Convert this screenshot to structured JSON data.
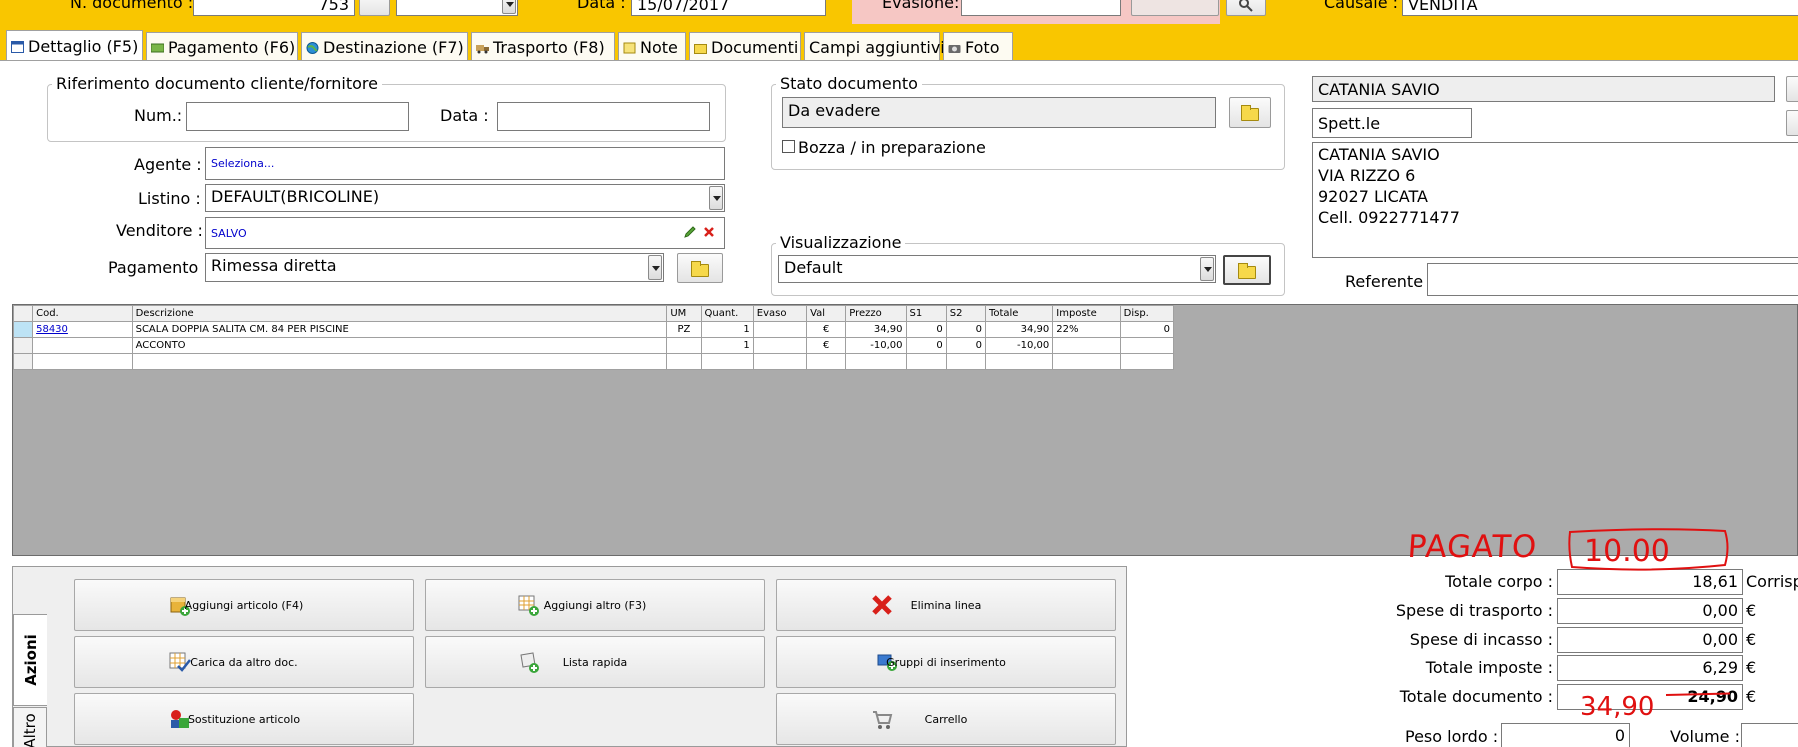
{
  "header": {
    "num_doc_label": "N. documento :",
    "num_doc_value": "753",
    "data_label": "Data :",
    "data_value": "15/07/2017",
    "evasione_label": "Evasione:",
    "causale_label": "Causale :",
    "causale_value": "VENDITA"
  },
  "tabs": [
    {
      "label": "Dettaglio (F5)"
    },
    {
      "label": "Pagamento (F6)"
    },
    {
      "label": "Destinazione (F7)"
    },
    {
      "label": "Trasporto (F8)"
    },
    {
      "label": "Note"
    },
    {
      "label": "Documenti"
    },
    {
      "label": "Campi aggiuntivi"
    },
    {
      "label": "Foto"
    }
  ],
  "riferimento": {
    "title": "Riferimento documento cliente/fornitore",
    "num_label": "Num.:",
    "num_value": "",
    "data_label": "Data :",
    "data_value": ""
  },
  "stato": {
    "title": "Stato documento",
    "value": "Da evadere",
    "bozza_label": "Bozza / in preparazione"
  },
  "visualizzazione": {
    "title": "Visualizzazione",
    "value": "Default"
  },
  "form": {
    "agente_label": "Agente :",
    "agente_value": "Seleziona...",
    "listino_label": "Listino :",
    "listino_value": "DEFAULT(BRICOLINE)",
    "venditore_label": "Venditore :",
    "venditore_value": "SALVO",
    "pagamento_label": "Pagamento :",
    "pagamento_value": "Rimessa diretta"
  },
  "cliente": {
    "nome": "CATANIA SAVIO",
    "titolo": "Spett.le",
    "indirizzo_righe": [
      "CATANIA SAVIO",
      "VIA RIZZO 6",
      "92027  LICATA",
      "Cell. 0922771477"
    ],
    "referente_label": "Referente",
    "referente_value": ""
  },
  "grid": {
    "columns": [
      "Cod.",
      "Descrizione",
      "UM",
      "Quant.",
      "Evaso",
      "Val",
      "Prezzo",
      "S1",
      "S2",
      "Totale",
      "Imposte",
      "Disp."
    ],
    "rows": [
      {
        "cod": "58430",
        "descrizione": "SCALA DOPPIA SALITA CM. 84 PER PISCINE",
        "um": "PZ",
        "quant": "1",
        "evaso": "",
        "val": "€",
        "prezzo": "34,90",
        "s1": "0",
        "s2": "0",
        "totale": "34,90",
        "imposte": "22%",
        "disp": "0"
      },
      {
        "cod": "",
        "descrizione": "ACCONTO",
        "um": "",
        "quant": "1",
        "evaso": "",
        "val": "€",
        "prezzo": "-10,00",
        "s1": "0",
        "s2": "0",
        "totale": "-10,00",
        "imposte": "",
        "disp": ""
      }
    ]
  },
  "side_tabs": {
    "azioni": "Azioni",
    "altro": "Altro"
  },
  "actions": {
    "aggiungi_articolo": "Aggiungi articolo (F4)",
    "aggiungi_altro": "Aggiungi altro (F3)",
    "elimina_linea": "Elimina linea",
    "carica_altro_doc": "Carica da altro doc.",
    "lista_rapida": "Lista rapida",
    "gruppi_inserimento": "Gruppi di inserimento",
    "sostituzione_articolo": "Sostituzione articolo",
    "carrello": "Carrello"
  },
  "totals": {
    "totale_corpo_label": "Totale corpo :",
    "totale_corpo_value": "18,61",
    "totale_corpo_suffix": "Corrisp",
    "spese_trasporto_label": "Spese di trasporto :",
    "spese_trasporto_value": "0,00",
    "spese_incasso_label": "Spese di incasso :",
    "spese_incasso_value": "0,00",
    "totale_imposte_label": "Totale imposte :",
    "totale_imposte_value": "6,29",
    "totale_documento_label": "Totale documento :",
    "totale_documento_value": "24,90",
    "currency": "€",
    "peso_lordo_label": "Peso lordo :",
    "peso_lordo_value": "0",
    "volume_label": "Volume :"
  },
  "annotations": {
    "pagato_text": "PAGATO",
    "pagato_amount": "10.00",
    "corrected_total": "34,90"
  },
  "colors": {
    "header_yellow": "#f9c600",
    "pink_field_bg": "#f6c7c4",
    "handwriting_red": "#e01010",
    "grid_bg": "#ababab",
    "link_blue": "#0000cc"
  }
}
